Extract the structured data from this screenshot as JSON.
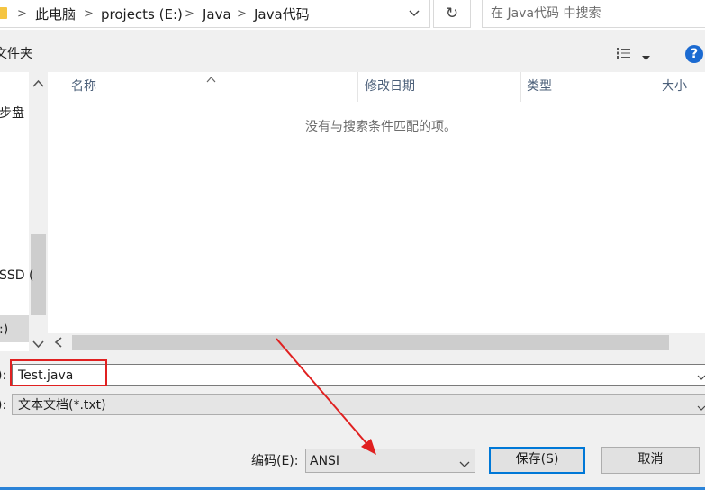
{
  "address": {
    "crumbs": [
      "此电脑",
      "projects (E:)",
      "Java",
      "Java代码"
    ],
    "separator": ">"
  },
  "search": {
    "placeholder": "在 Java代码 中搜索"
  },
  "toolbar": {
    "new_folder_label": "文件夹",
    "help_label": "?"
  },
  "nav": {
    "items": [
      "步盘",
      "SSD (",
      ":)"
    ]
  },
  "file_list": {
    "columns": [
      "名称",
      "修改日期",
      "类型",
      "大小"
    ],
    "empty_message": "没有与搜索条件匹配的项。"
  },
  "form": {
    "filename_label": "):",
    "filename_value": "Test.java",
    "filetype_label": "):",
    "filetype_value": "文本文档(*.txt)",
    "encoding_label": "编码(E):",
    "encoding_value": "ANSI"
  },
  "buttons": {
    "save": "保存(S)",
    "cancel": "取消"
  },
  "colors": {
    "annotation": "#e02020",
    "accent": "#0078d7",
    "help": "#1b6ad1"
  }
}
